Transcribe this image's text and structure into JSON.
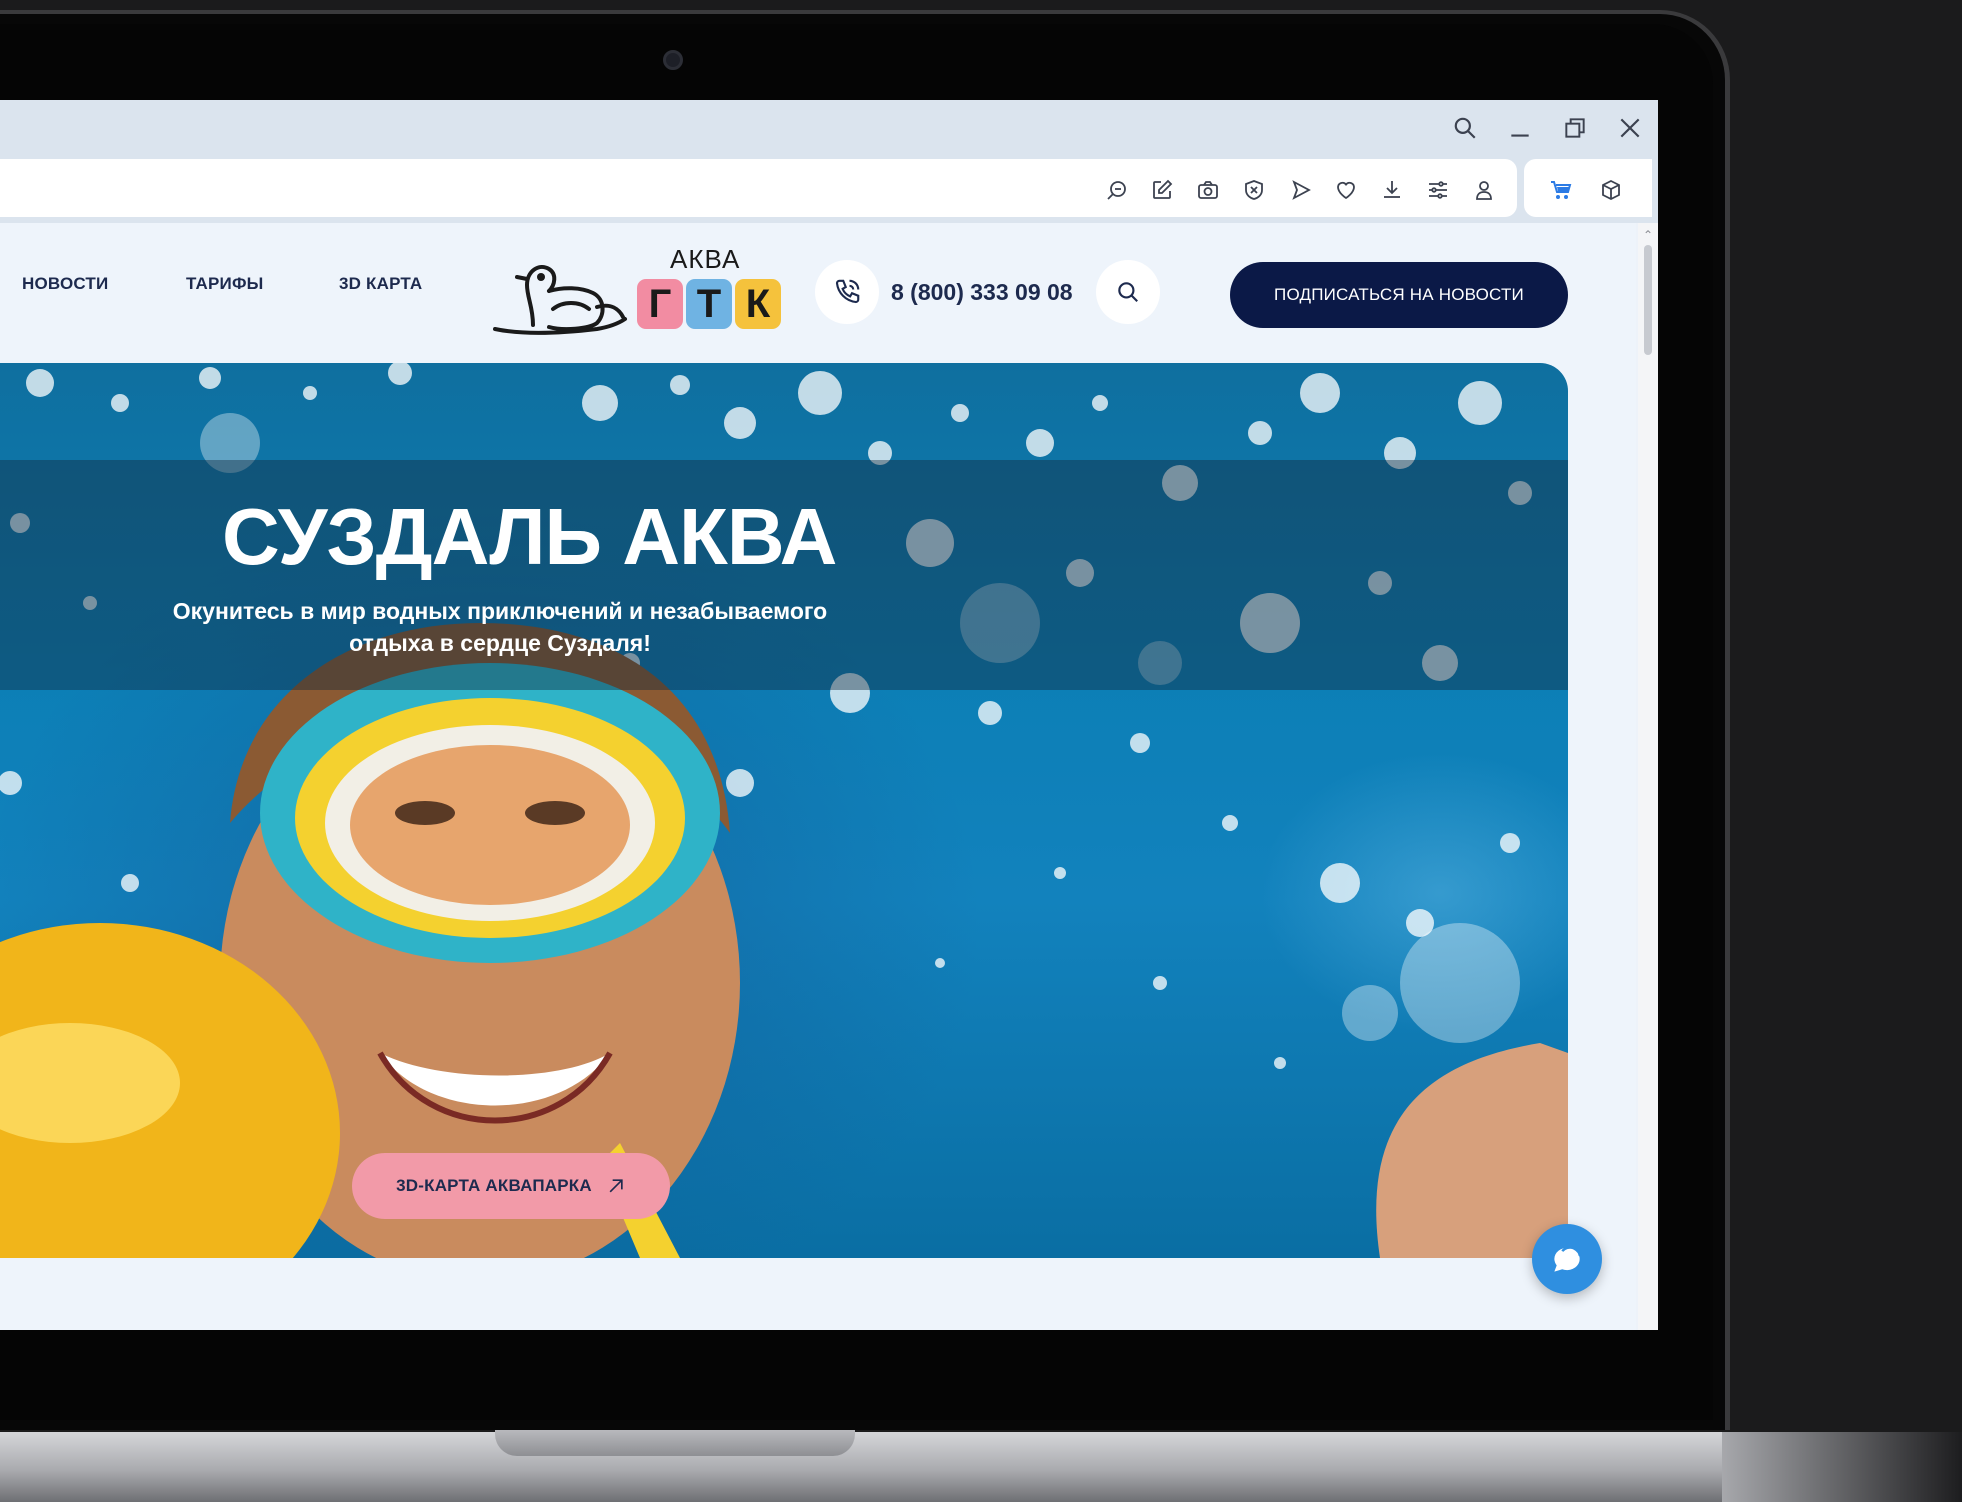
{
  "nav": {
    "items": [
      {
        "label": "НОВОСТИ"
      },
      {
        "label": "ТАРИФЫ"
      },
      {
        "label": "3D КАРТА"
      }
    ]
  },
  "logo": {
    "top_text": "АКВА",
    "letters": [
      "Г",
      "Т",
      "К"
    ],
    "tile_colors": [
      "#f28ca2",
      "#6fb3e3",
      "#f5c23c"
    ]
  },
  "header": {
    "phone": "8 (800) 333 09 08",
    "subscribe_label": "ПОДПИСАТЬСЯ НА НОВОСТИ"
  },
  "hero": {
    "title_light": "СУЗДАЛЬ",
    "title_bold": "АКВА",
    "subtitle": "Окунитесь в мир водных приключений и незабываемого отдыха в сердце Суздаля!",
    "map_button": "3D-КАРТА АКВАПАРКА"
  },
  "colors": {
    "brand_navy": "#0b1947",
    "button_pink": "#f29aa8",
    "chat_blue": "#2f8fe0",
    "extension_accent": "#6b4ef6"
  },
  "browser": {
    "toolbar_icons": [
      "find-in-page-icon",
      "edit-icon",
      "camera-icon",
      "shield-icon",
      "send-icon",
      "heart-icon",
      "download-icon",
      "settings-sliders-icon",
      "profile-icon"
    ],
    "extension_icons": [
      "cart-icon",
      "box-icon"
    ],
    "window_controls": [
      "search-icon",
      "minimize-icon",
      "restore-icon",
      "close-icon"
    ]
  }
}
